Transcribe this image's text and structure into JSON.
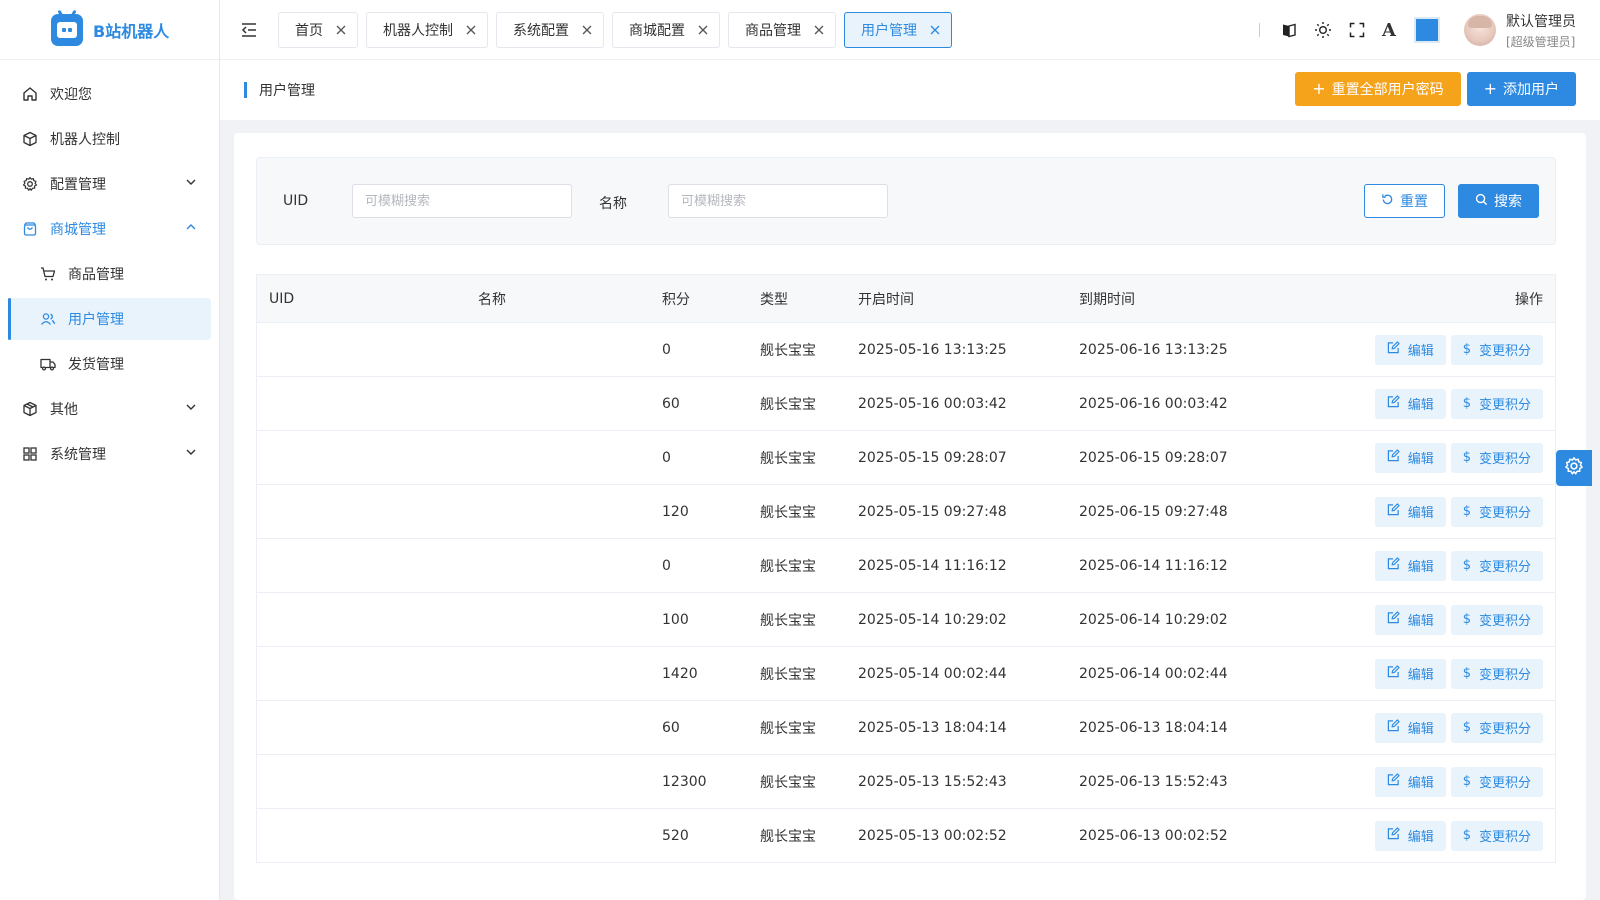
{
  "app": {
    "name": "B站机器人"
  },
  "sidebar": {
    "items": [
      {
        "label": "欢迎您",
        "icon": "home-icon"
      },
      {
        "label": "机器人控制",
        "icon": "cube-icon"
      },
      {
        "label": "配置管理",
        "icon": "gear-icon"
      },
      {
        "label": "商城管理",
        "icon": "bag-icon"
      },
      {
        "label": "商品管理",
        "icon": "cart-icon"
      },
      {
        "label": "用户管理",
        "icon": "users-icon"
      },
      {
        "label": "发货管理",
        "icon": "truck-icon"
      },
      {
        "label": "其他",
        "icon": "box-icon"
      },
      {
        "label": "系统管理",
        "icon": "grid-icon"
      }
    ]
  },
  "tabs": [
    {
      "label": "首页"
    },
    {
      "label": "机器人控制"
    },
    {
      "label": "系统配置"
    },
    {
      "label": "商城配置"
    },
    {
      "label": "商品管理"
    },
    {
      "label": "用户管理",
      "active": true
    }
  ],
  "header": {
    "font_icon_label": "A",
    "accent_color": "#2d8ae0",
    "user_name": "默认管理员",
    "user_role": "[超级管理员]"
  },
  "page": {
    "title": "用户管理",
    "reset_all_label": "重置全部用户密码",
    "add_user_label": "添加用户"
  },
  "search": {
    "uid_label": "UID",
    "uid_placeholder": "可模糊搜索",
    "name_label": "名称",
    "name_placeholder": "可模糊搜索",
    "reset_label": "重置",
    "search_label": "搜索"
  },
  "table": {
    "headers": {
      "uid": "UID",
      "name": "名称",
      "points": "积分",
      "type": "类型",
      "start": "开启时间",
      "end": "到期时间",
      "ops": "操作"
    },
    "edit_label": "编辑",
    "change_points_label": "变更积分",
    "rows": [
      {
        "uid": "",
        "name": "",
        "points": "0",
        "type": "舰长宝宝",
        "start": "2025-05-16 13:13:25",
        "end": "2025-06-16 13:13:25"
      },
      {
        "uid": "",
        "name": "",
        "points": "60",
        "type": "舰长宝宝",
        "start": "2025-05-16 00:03:42",
        "end": "2025-06-16 00:03:42"
      },
      {
        "uid": "",
        "name": "",
        "points": "0",
        "type": "舰长宝宝",
        "start": "2025-05-15 09:28:07",
        "end": "2025-06-15 09:28:07"
      },
      {
        "uid": "",
        "name": "",
        "points": "120",
        "type": "舰长宝宝",
        "start": "2025-05-15 09:27:48",
        "end": "2025-06-15 09:27:48"
      },
      {
        "uid": "",
        "name": "",
        "points": "0",
        "type": "舰长宝宝",
        "start": "2025-05-14 11:16:12",
        "end": "2025-06-14 11:16:12"
      },
      {
        "uid": "",
        "name": "",
        "points": "100",
        "type": "舰长宝宝",
        "start": "2025-05-14 10:29:02",
        "end": "2025-06-14 10:29:02"
      },
      {
        "uid": "",
        "name": "",
        "points": "1420",
        "type": "舰长宝宝",
        "start": "2025-05-14 00:02:44",
        "end": "2025-06-14 00:02:44"
      },
      {
        "uid": "",
        "name": "",
        "points": "60",
        "type": "舰长宝宝",
        "start": "2025-05-13 18:04:14",
        "end": "2025-06-13 18:04:14"
      },
      {
        "uid": "",
        "name": "",
        "points": "12300",
        "type": "舰长宝宝",
        "start": "2025-05-13 15:52:43",
        "end": "2025-06-13 15:52:43"
      },
      {
        "uid": "",
        "name": "",
        "points": "520",
        "type": "舰长宝宝",
        "start": "2025-05-13 00:02:52",
        "end": "2025-06-13 00:02:52"
      }
    ]
  }
}
